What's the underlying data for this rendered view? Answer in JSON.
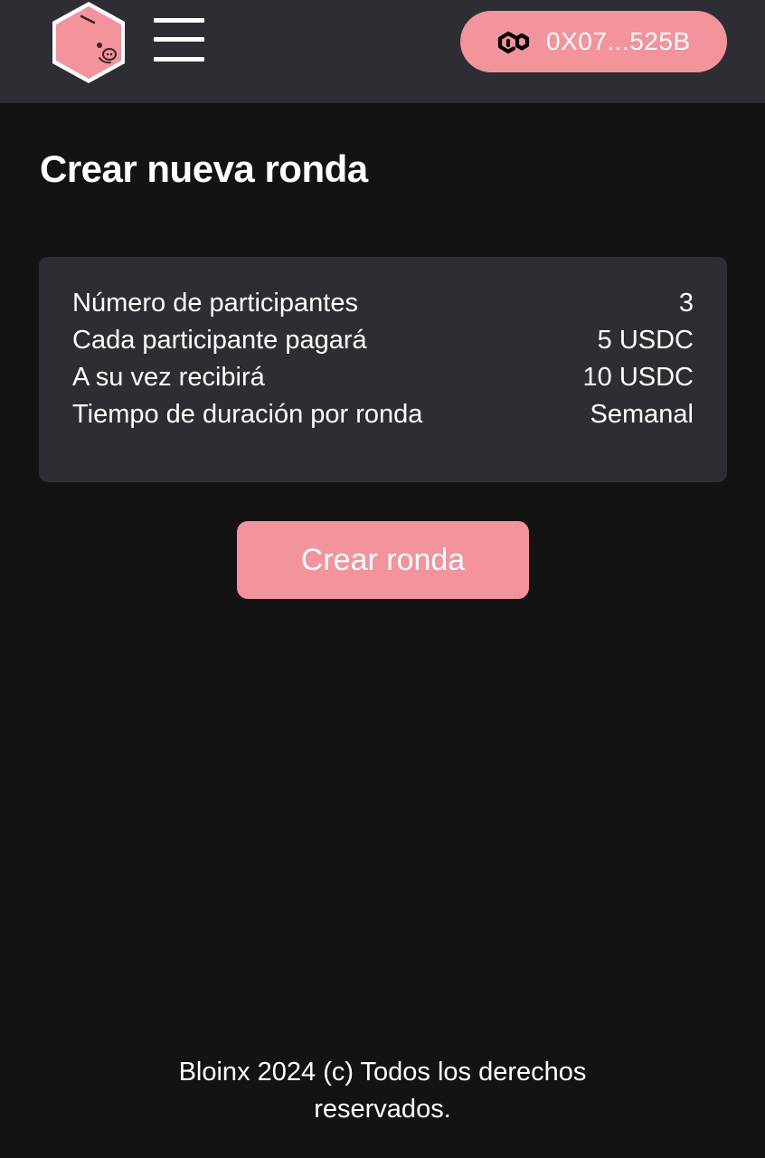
{
  "header": {
    "logo_icon": "piggy-bank-hexagon-icon",
    "menu_icon": "hamburger-menu-icon",
    "wallet": {
      "icon": "polygon-network-icon",
      "address": "0X07...525B"
    }
  },
  "main": {
    "title": "Crear nueva ronda",
    "summary": [
      {
        "label": "Número de participantes",
        "value": "3"
      },
      {
        "label": "Cada participante pagará",
        "value": "5 USDC"
      },
      {
        "label": "A su vez recibirá",
        "value": "10 USDC"
      },
      {
        "label": "Tiempo de duración por ronda",
        "value": "Semanal"
      }
    ],
    "create_button_label": "Crear ronda"
  },
  "footer": {
    "line1": "Bloinx 2024 (c) Todos los derechos",
    "line2": "reservados."
  },
  "colors": {
    "background": "#131313",
    "surface": "#2d2e33",
    "accent": "#f3939b",
    "text": "#ffffff"
  }
}
